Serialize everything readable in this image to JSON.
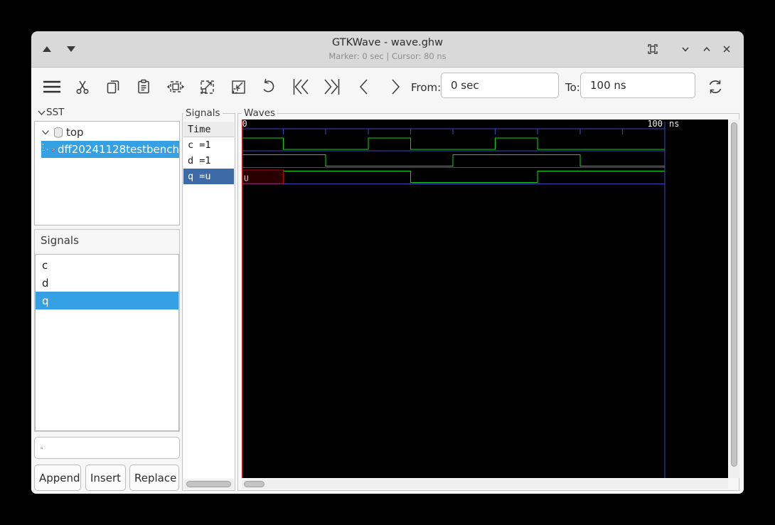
{
  "window": {
    "title": "GTKWave - wave.ghw",
    "subtitle": "Marker: 0 sec | Cursor: 80 ns"
  },
  "toolbar": {
    "from_label": "From:",
    "from_value": "0 sec",
    "to_label": "To:",
    "to_value": "100 ns"
  },
  "sst": {
    "header": "SST",
    "items": [
      {
        "label": "top",
        "selected": false
      },
      {
        "label": "dff20241128testbench",
        "selected": true
      }
    ]
  },
  "signals_panel": {
    "frame_label": "Signals",
    "items": [
      {
        "label": "c",
        "selected": false
      },
      {
        "label": "d",
        "selected": false
      },
      {
        "label": "q",
        "selected": true
      }
    ],
    "search_placeholder": ""
  },
  "actions": {
    "append": "Append",
    "insert": "Insert",
    "replace": "Replace"
  },
  "wave_names": {
    "frame_label": "Signals",
    "time_header": "Time",
    "rows": [
      {
        "label": "c =1",
        "selected": false
      },
      {
        "label": "d =1",
        "selected": false
      },
      {
        "label": "q =u",
        "selected": true
      }
    ]
  },
  "waves": {
    "frame_label": "Waves",
    "ruler": {
      "start_label": "0",
      "end_value": "100",
      "end_unit": "ns",
      "t_max": 100,
      "tick_ns": 10
    },
    "unknown_label": "U",
    "signals": [
      {
        "name": "c",
        "t_end": 100,
        "segments": [
          {
            "t": 0,
            "v": "1"
          },
          {
            "t": 10,
            "v": "0"
          },
          {
            "t": 30,
            "v": "1"
          },
          {
            "t": 40,
            "v": "0"
          },
          {
            "t": 60,
            "v": "1"
          },
          {
            "t": 70,
            "v": "0"
          }
        ]
      },
      {
        "name": "d",
        "t_end": 100,
        "segments": [
          {
            "t": 0,
            "v": "1"
          },
          {
            "t": 20,
            "v": "0"
          },
          {
            "t": 50,
            "v": "1"
          },
          {
            "t": 80,
            "v": "0"
          }
        ]
      },
      {
        "name": "q",
        "t_end": 100,
        "segments": [
          {
            "t": 0,
            "v": "U"
          },
          {
            "t": 10,
            "v": "1"
          },
          {
            "t": 40,
            "v": "0"
          },
          {
            "t": 70,
            "v": "1"
          }
        ]
      }
    ]
  },
  "colors": {
    "selection_blue": "#35a1e4",
    "wave_name_selection": "#3e6aa8",
    "wave_green": "#0fd60f",
    "grid_blue": "#4343bb",
    "marker_red": "#cc2222",
    "unknown_fill": "#2b0000",
    "unknown_border": "#bb0000",
    "canvas_bg": "#000000",
    "ruler_text": "#f0f0f0"
  }
}
